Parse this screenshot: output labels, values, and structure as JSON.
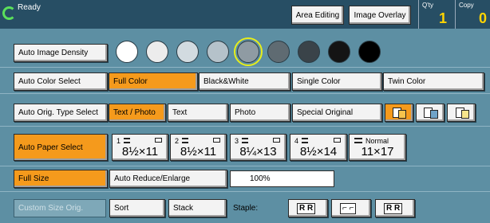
{
  "status": {
    "text": "Ready"
  },
  "header": {
    "area_editing": "Area Editing",
    "image_overlay": "Image Overlay",
    "qty_label": "Q'ty",
    "qty_value": "1",
    "copy_label": "Copy",
    "copy_value": "0"
  },
  "density": {
    "label": "Auto Image Density",
    "levels": [
      "#ffffff",
      "#ececec",
      "#d2dbe0",
      "#b5c2ca",
      "#8f9ba3",
      "#5f6b72",
      "#3a4349",
      "#141414",
      "#000000"
    ],
    "selected_index": 4
  },
  "color": {
    "auto": "Auto Color Select",
    "options": [
      "Full Color",
      "Black&White",
      "Single Color",
      "Twin Color"
    ],
    "selected": "Full Color"
  },
  "orig_type": {
    "auto": "Auto Orig. Type Select",
    "options": [
      "Text / Photo",
      "Text",
      "Photo",
      "Special Original"
    ],
    "selected": "Text / Photo",
    "icons": [
      "original-set-icon",
      "original-scan-icon",
      "original-feed-icon"
    ]
  },
  "paper": {
    "auto": "Auto Paper Select",
    "trays": [
      {
        "num": "1",
        "size": "8½×11"
      },
      {
        "num": "2",
        "size": "8½×11"
      },
      {
        "num": "3",
        "size": "8¼×13"
      },
      {
        "num": "4",
        "size": "8½×14"
      }
    ],
    "bypass": {
      "type": "Normal",
      "size": "11×17"
    }
  },
  "zoom": {
    "full_size": "Full Size",
    "auto_reduce": "Auto Reduce/Enlarge",
    "value": "100%"
  },
  "finish": {
    "custom_size": "Custom Size Orig.",
    "sort": "Sort",
    "stack": "Stack",
    "staple_label": "Staple:",
    "staple_options": [
      "R R",
      "⌐ ⌐",
      "R R"
    ]
  }
}
